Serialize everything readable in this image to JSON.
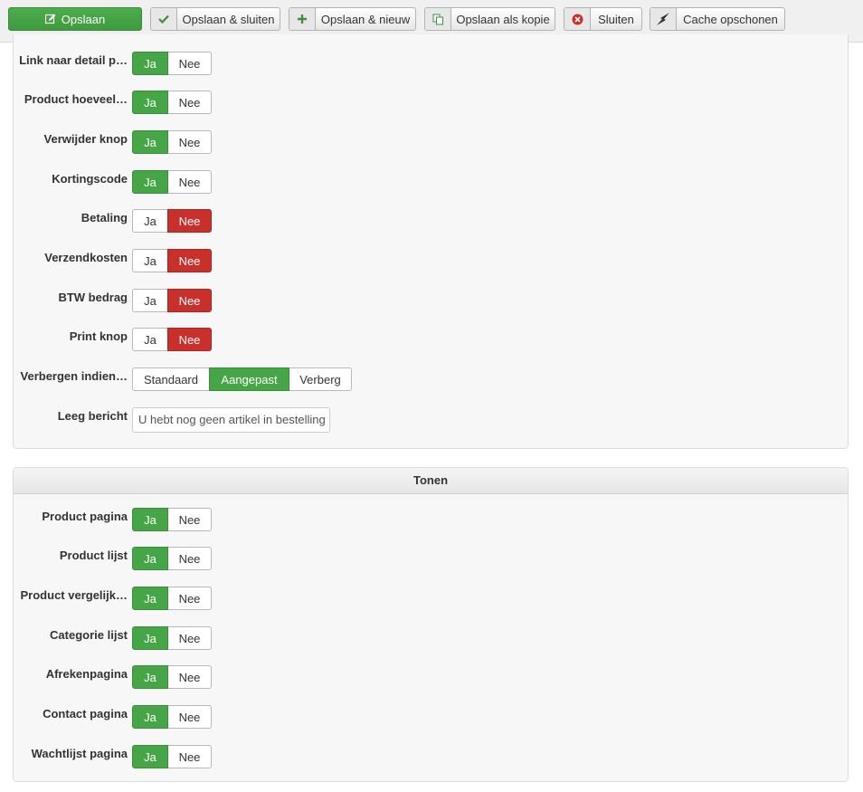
{
  "toolbar": {
    "save": "Opslaan",
    "save_close": "Opslaan & sluiten",
    "save_new": "Opslaan & nieuw",
    "save_copy": "Opslaan als kopie",
    "close": "Sluiten",
    "clear_cache": "Cache opschonen"
  },
  "toggle_labels": {
    "yes": "Ja",
    "no": "Nee"
  },
  "section1": {
    "rows": [
      {
        "label": "Link naar detail p…",
        "value": "Ja"
      },
      {
        "label": "Product hoeveel…",
        "value": "Ja"
      },
      {
        "label": "Verwijder knop",
        "value": "Ja"
      },
      {
        "label": "Kortingscode",
        "value": "Ja"
      },
      {
        "label": "Betaling",
        "value": "Nee"
      },
      {
        "label": "Verzendkosten",
        "value": "Nee"
      },
      {
        "label": "BTW bedrag",
        "value": "Nee"
      },
      {
        "label": "Print knop",
        "value": "Nee"
      }
    ],
    "hide": {
      "label": "Verbergen indien…",
      "options": [
        "Standaard",
        "Aangepast",
        "Verberg"
      ],
      "selected": "Aangepast"
    },
    "empty_message": {
      "label": "Leeg bericht",
      "value": "U hebt nog geen artikel in bestelling"
    }
  },
  "section2": {
    "title": "Tonen",
    "rows": [
      {
        "label": "Product pagina",
        "value": "Ja"
      },
      {
        "label": "Product lijst",
        "value": "Ja"
      },
      {
        "label": "Product vergelijk…",
        "value": "Ja"
      },
      {
        "label": "Categorie lijst",
        "value": "Ja"
      },
      {
        "label": "Afrekenpagina",
        "value": "Ja"
      },
      {
        "label": "Contact pagina",
        "value": "Ja"
      },
      {
        "label": "Wachtlijst pagina",
        "value": "Ja"
      }
    ]
  },
  "colors": {
    "green": "#46a546",
    "red": "#c9302c"
  }
}
